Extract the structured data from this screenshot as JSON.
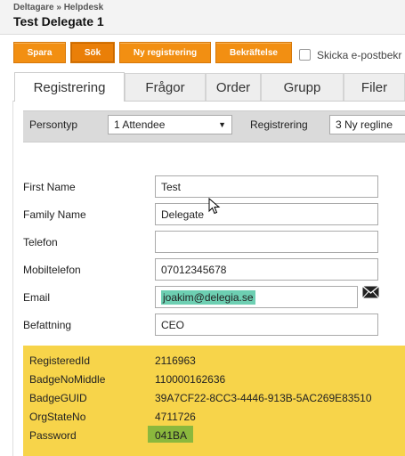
{
  "header": {
    "breadcrumb": "Deltagare » Helpdesk",
    "title": "Test Delegate 1"
  },
  "toolbar": {
    "save_label": "Spara",
    "search_label": "Sök",
    "new_label": "Ny registrering",
    "confirm_label": "Bekräftelse",
    "email_checkbox_label": "Skicka e-postbekr"
  },
  "tabs": [
    {
      "label": "Registrering",
      "active": true
    },
    {
      "label": "Frågor"
    },
    {
      "label": "Order"
    },
    {
      "label": "Grupp"
    },
    {
      "label": "Filer"
    }
  ],
  "selectors": {
    "persontyp_label": "Persontyp",
    "persontyp_value": "1 Attendee",
    "registrering_label": "Registrering",
    "registrering_value": "3 Ny regline"
  },
  "fields": {
    "first_name": {
      "label": "First Name",
      "value": "Test"
    },
    "family_name": {
      "label": "Family Name",
      "value": "Delegate"
    },
    "telefon": {
      "label": "Telefon",
      "value": ""
    },
    "mobiltelefon": {
      "label": "Mobiltelefon",
      "value": "07012345678"
    },
    "email": {
      "label": "Email",
      "value": "joakim@delegia.se"
    },
    "befattning": {
      "label": "Befattning",
      "value": "CEO"
    }
  },
  "info": {
    "registered_id": {
      "label": "RegisteredId",
      "value": "2116963"
    },
    "badge_no_middle": {
      "label": "BadgeNoMiddle",
      "value": "110000162636"
    },
    "badge_guid": {
      "label": "BadgeGUID",
      "value": "39A7CF22-8CC3-4446-913B-5AC269E83510"
    },
    "org_state_no": {
      "label": "OrgStateNo",
      "value": "4711726"
    },
    "password": {
      "label": "Password",
      "value": "041BA"
    }
  },
  "colors": {
    "accent": "#f28f12",
    "info_panel": "#f7d44a",
    "email_highlight": "#6dcfb2",
    "password_highlight": "#8bb83d"
  },
  "icons": {
    "mail": "envelope-icon",
    "dropdown": "chevron-down-icon",
    "cursor": "mouse-pointer-icon"
  }
}
